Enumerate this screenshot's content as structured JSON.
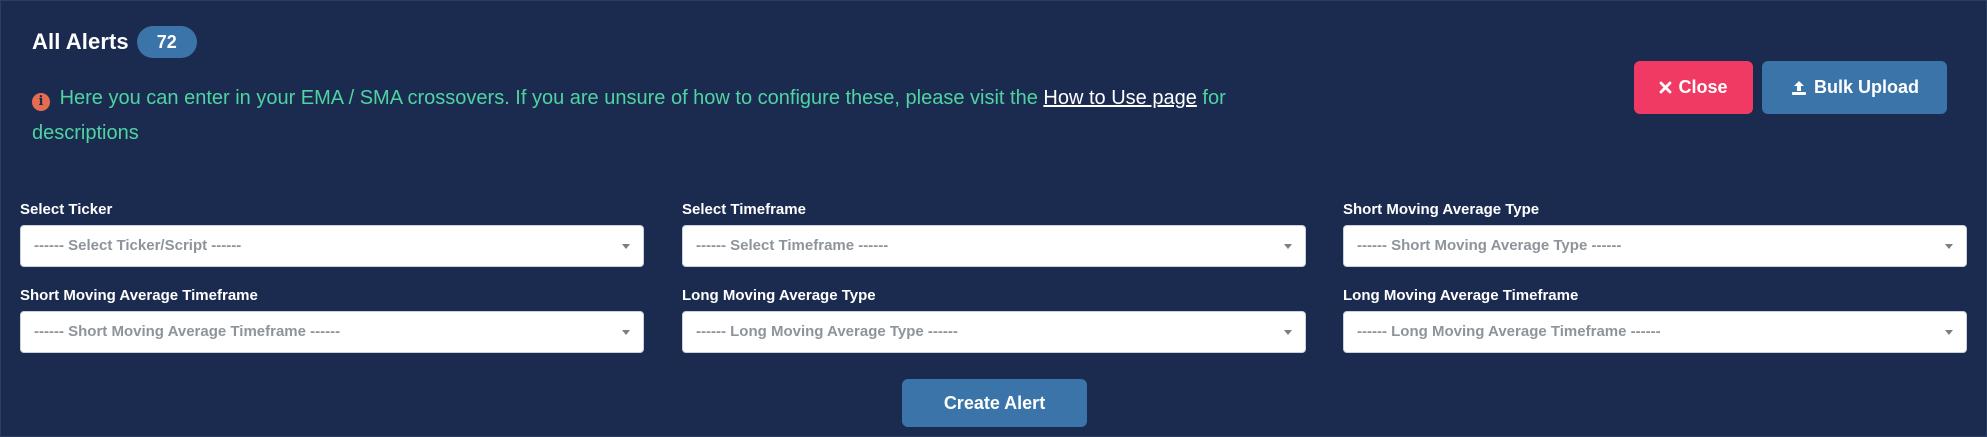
{
  "header": {
    "title": "All Alerts",
    "count": "72"
  },
  "info": {
    "icon": "info-circle-icon",
    "text_before": "Here you can enter in your EMA / SMA crossovers. If you are unsure of how to configure these, please visit the",
    "link_text": "How to Use page",
    "text_after": "for descriptions",
    "color": "#4fd3a2"
  },
  "actions": {
    "close_label": "Close",
    "bulk_upload_label": "Bulk Upload",
    "create_alert_label": "Create Alert",
    "close_color": "#f03a63",
    "primary_color": "#3a74a8"
  },
  "fields": [
    {
      "label": "Select Ticker",
      "placeholder": "------ Select Ticker/Script ------"
    },
    {
      "label": "Select Timeframe",
      "placeholder": "------ Select Timeframe ------"
    },
    {
      "label": "Short Moving Average Type",
      "placeholder": "------ Short Moving Average Type ------"
    },
    {
      "label": "Short Moving Average Timeframe",
      "placeholder": "------ Short Moving Average Timeframe ------"
    },
    {
      "label": "Long Moving Average Type",
      "placeholder": "------ Long Moving Average Type ------"
    },
    {
      "label": "Long Moving Average Timeframe",
      "placeholder": "------ Long Moving Average Timeframe ------"
    }
  ],
  "theme": {
    "background": "#1b2b4f",
    "text": "#ffffff"
  }
}
